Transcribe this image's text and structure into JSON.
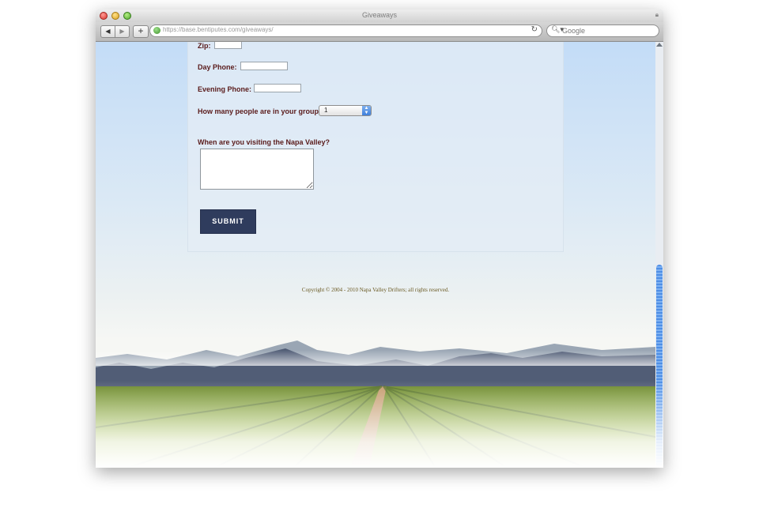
{
  "browser": {
    "title": "Giveaways",
    "url": "https://base.bentiputes.com/giveaways/",
    "search_placeholder": "Google",
    "buttons": {
      "back": "◀",
      "forward": "▶",
      "add": "+"
    }
  },
  "form": {
    "fields": [
      {
        "label": "Zip:",
        "value": ""
      },
      {
        "label": "Day Phone:",
        "value": ""
      },
      {
        "label": "Evening Phone:",
        "value": ""
      }
    ],
    "group_question": "How many people are in your group?",
    "group_selected": "1",
    "visit_question": "When are you visiting the Napa Valley?",
    "visit_value": "",
    "submit_label": "SUBMIT"
  },
  "footer": {
    "copyright": "Copyright © 2004 - 2010 Napa Valley Drifters; all rights reserved."
  },
  "colors": {
    "label": "#5a1b1b",
    "submit_bg": "#2f3c5d",
    "copyright": "#6a5a23",
    "scroll_thumb": "#4f8fe6"
  },
  "icons": {
    "reload": "reload-icon",
    "search": "search-icon",
    "lock": "lock-icon"
  }
}
